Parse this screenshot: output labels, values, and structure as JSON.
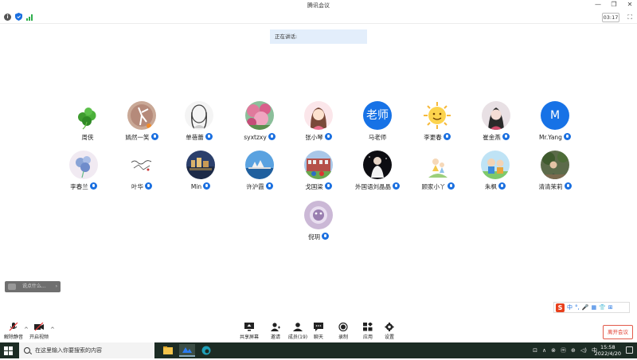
{
  "window": {
    "title": "腾讯会议"
  },
  "status": {
    "timer": "03:17"
  },
  "speaking_banner": {
    "text": "正在讲话:"
  },
  "participants": [
    {
      "name": "周侠",
      "mic": false
    },
    {
      "name": "嫣然一笑",
      "mic": true
    },
    {
      "name": "单蓓蕾",
      "mic": true
    },
    {
      "name": "syxtzxy",
      "mic": true
    },
    {
      "name": "张小琴",
      "mic": true
    },
    {
      "name": "马老师",
      "mic": false,
      "avatar_text": "老师"
    },
    {
      "name": "李更春",
      "mic": true
    },
    {
      "name": "崔金燕",
      "mic": true
    },
    {
      "name": "Mr.Yang",
      "mic": true,
      "avatar_text": "M"
    },
    {
      "name": "李春兰",
      "mic": true
    },
    {
      "name": "叶华",
      "mic": true
    },
    {
      "name": "Min",
      "mic": true
    },
    {
      "name": "许沪霞",
      "mic": true
    },
    {
      "name": "戈国梁",
      "mic": true
    },
    {
      "name": "外国语刘晶晶",
      "mic": true
    },
    {
      "name": "顾家小丫",
      "mic": true
    },
    {
      "name": "朱枫",
      "mic": true
    },
    {
      "name": "清清茉莉",
      "mic": true
    },
    {
      "name": "倪玥",
      "mic": true
    }
  ],
  "chat": {
    "placeholder": "说点什么..."
  },
  "ime": {
    "items": [
      "中",
      "°,",
      "🎤",
      "▦",
      "👕",
      "⊞"
    ]
  },
  "toolbar": {
    "unmute": "解除静音",
    "start_video": "开启视频",
    "share_screen": "共享屏幕",
    "invite": "邀请",
    "members": "成员(19)",
    "chat": "聊天",
    "record": "录制",
    "apps": "应用",
    "settings": "设置",
    "leave": "离开会议"
  },
  "taskbar": {
    "search_placeholder": "在这里输入你要搜索的内容",
    "tray": [
      "⊡",
      "∧",
      "⊗",
      "ⓜ",
      "⊕",
      "◁)",
      "中"
    ],
    "time": "15:58",
    "date": "2022/4/20"
  }
}
